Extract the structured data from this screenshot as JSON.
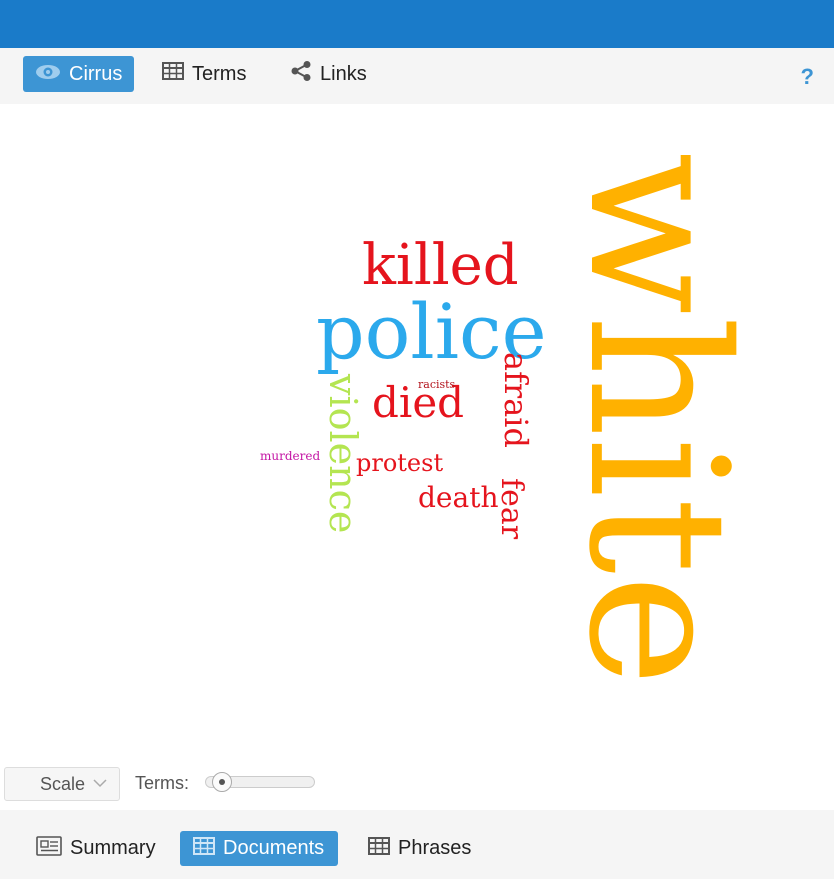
{
  "top_tabs": [
    {
      "label": "Cirrus",
      "icon": "eye-icon",
      "active": true
    },
    {
      "label": "Terms",
      "icon": "table-icon",
      "active": false
    },
    {
      "label": "Links",
      "icon": "share-icon",
      "active": false
    }
  ],
  "help_label": "?",
  "cloud": {
    "words": [
      {
        "text": "white",
        "color": "#ffb100"
      },
      {
        "text": "killed",
        "color": "#e5141d"
      },
      {
        "text": "police",
        "color": "#2ba9ec"
      },
      {
        "text": "afraid",
        "color": "#e5141d"
      },
      {
        "text": "violence",
        "color": "#b4e551"
      },
      {
        "text": "died",
        "color": "#e5141d"
      },
      {
        "text": "racists",
        "color": "#b3141d"
      },
      {
        "text": "protest",
        "color": "#e5141d"
      },
      {
        "text": "murdered",
        "color": "#c416a4"
      },
      {
        "text": "death",
        "color": "#e5141d"
      },
      {
        "text": "fear",
        "color": "#e5141d"
      }
    ]
  },
  "controls": {
    "scale_label": "Scale",
    "terms_label": "Terms:",
    "terms_slider_fraction": 0.05
  },
  "bottom_tabs": [
    {
      "label": "Summary",
      "icon": "newspaper-icon",
      "active": false
    },
    {
      "label": "Documents",
      "icon": "table-icon",
      "active": true
    },
    {
      "label": "Phrases",
      "icon": "table-icon",
      "active": false
    }
  ],
  "colors": {
    "header": "#1a7bc9",
    "accent": "#3d95d4"
  }
}
